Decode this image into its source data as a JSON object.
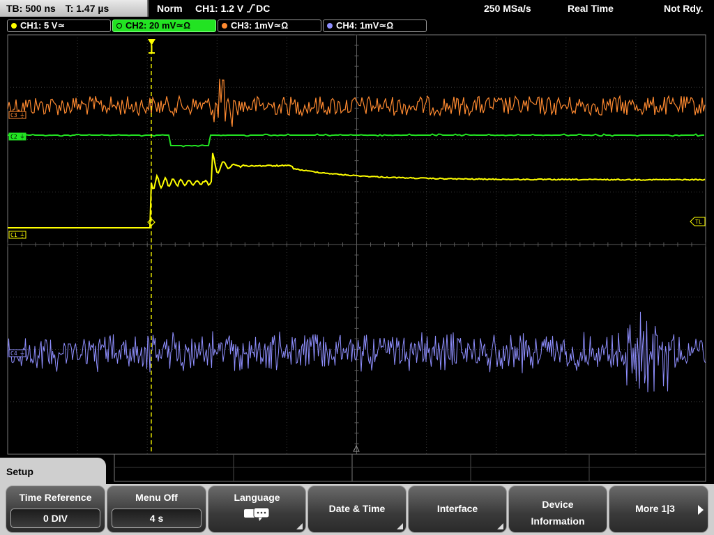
{
  "top_bar": {
    "tb": "TB: 500 ns",
    "t": "T: 1.47 µs",
    "mode": "Norm",
    "trigger": "CH1: 1.2 V",
    "trigger_coupling": "DC",
    "sample_rate": "250 MSa/s",
    "acq_mode": "Real Time",
    "status": "Not Rdy."
  },
  "channels": [
    {
      "label": "CH1: 5 V≃",
      "color": "#ffff00",
      "active": false
    },
    {
      "label": "CH2: 20 mV≃Ω",
      "color": "#22e322",
      "active": true
    },
    {
      "label": "CH3: 1mV≃Ω",
      "color": "#ff8a30",
      "active": false
    },
    {
      "label": "CH4: 1mV≃Ω",
      "color": "#8f8fff",
      "active": false
    }
  ],
  "trace_markers": {
    "c1": "C1",
    "c2": "C2",
    "c3": "C3",
    "c4": "C4",
    "trigger_level": "TL"
  },
  "colors": {
    "ch1": "#ffff00",
    "ch2": "#22e322",
    "ch3": "#ff8a30",
    "ch4": "#8f8fff",
    "grid": "#4a4a4a"
  },
  "menu": {
    "title": "Setup",
    "softkeys": [
      {
        "label": "Time Reference",
        "value": "0 DIV"
      },
      {
        "label": "Menu Off",
        "value": "4 s"
      },
      {
        "label": "Language",
        "icon": "speech-bubble-icon"
      },
      {
        "label": "Date & Time"
      },
      {
        "label": "Interface"
      },
      {
        "label1": "Device",
        "label2": "Information"
      },
      {
        "label": "More 1|3"
      }
    ]
  }
}
